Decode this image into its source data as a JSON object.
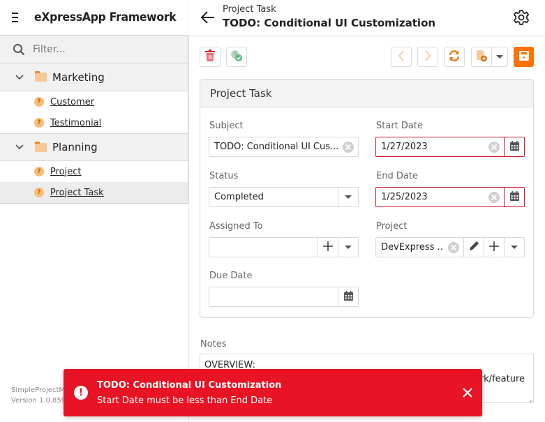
{
  "app": {
    "title": "eXpressApp Framework"
  },
  "sidebar": {
    "filter_placeholder": "Filter...",
    "groups": [
      {
        "label": "Marketing",
        "items": [
          {
            "label": "Customer"
          },
          {
            "label": "Testimonial"
          }
        ]
      },
      {
        "label": "Planning",
        "items": [
          {
            "label": "Project"
          },
          {
            "label": "Project Task",
            "selected": true
          }
        ]
      }
    ],
    "version_line1": "SimpleProjectM",
    "version_line2": "Version 1.0.859"
  },
  "header": {
    "breadcrumb": "Project Task",
    "title": "TODO: Conditional UI Customization"
  },
  "toolbar": {
    "delete": "trash-icon",
    "state": "clock-check-icon",
    "previous": "chevron-left-icon",
    "next": "chevron-right-icon",
    "refresh": "refresh-icon",
    "new": "new-record-icon",
    "save": "save-icon",
    "colors": {
      "accent": "#ff7200",
      "danger": "#d3142b"
    }
  },
  "form": {
    "card_title": "Project Task",
    "fields": {
      "subject": {
        "label": "Subject",
        "value": "TODO: Conditional UI Cus..."
      },
      "start_date": {
        "label": "Start Date",
        "value": "1/27/2023",
        "invalid": true
      },
      "status": {
        "label": "Status",
        "value": "Completed"
      },
      "end_date": {
        "label": "End Date",
        "value": "1/25/2023",
        "invalid": true
      },
      "assigned_to": {
        "label": "Assigned To",
        "value": ""
      },
      "project": {
        "label": "Project",
        "value": "DevExpress ..."
      },
      "due_date": {
        "label": "Due Date",
        "value": ""
      }
    },
    "notes": {
      "label": "Notes",
      "line1": "OVERVIEW:",
      "line2_visible": "rk/feature"
    }
  },
  "toast": {
    "title": "TODO: Conditional UI Customization",
    "message": "Start Date must be less than End Date",
    "color": "#e81325"
  }
}
